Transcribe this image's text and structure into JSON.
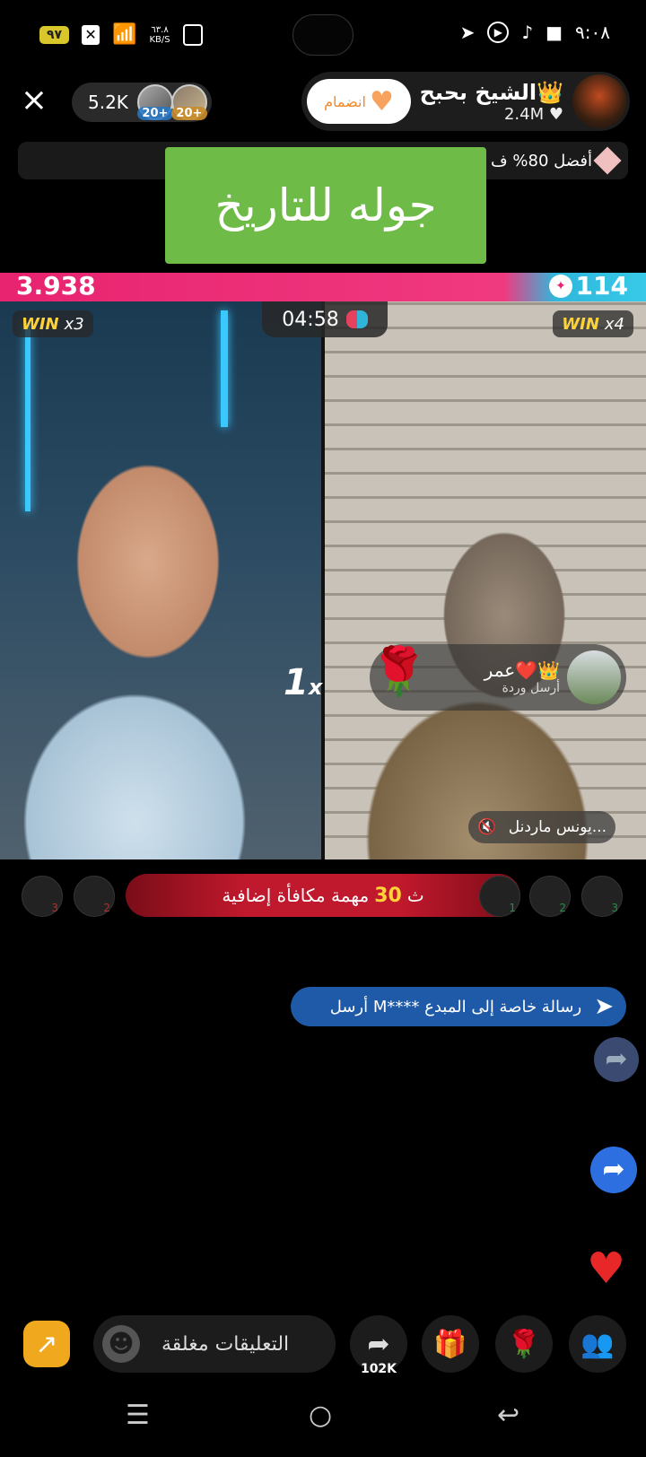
{
  "status_bar": {
    "battery": "٩٧",
    "speed_top": "٦٣.٨",
    "speed_bottom": "KB/S",
    "time": "٩:٠٨",
    "icons": [
      "telegram-icon",
      "youtube-icon",
      "tiktok-icon",
      "camera-icon",
      "wifi-icon",
      "vibrate-icon"
    ]
  },
  "header": {
    "viewer_count": "5.2K",
    "viewer_avatars": [
      {
        "badge": "20+"
      },
      {
        "badge": "20+"
      }
    ],
    "host_name": "الشيخ بحبح👑",
    "host_likes": "2.4M",
    "join_label": "انضمام"
  },
  "subbar": {
    "text": "أفضل 80% ف"
  },
  "sticker": {
    "text": "جوله للتاريخ"
  },
  "battle": {
    "score_left": "3.938",
    "score_right": "114",
    "win_left_label": "WIN",
    "win_left_mult": "x3",
    "win_right_label": "WIN",
    "win_right_mult": "x4",
    "timer": "04:58",
    "multiplier": "1",
    "multiplier_suffix": "x",
    "gift_sender": "عمر❤️👑",
    "gift_action": "أرسل وردة",
    "right_user": "يونس ماردنل...",
    "bonus_text": "مهمة مكافأة إضافية",
    "bonus_value": "30",
    "bonus_unit": "ث",
    "supporters_left": [
      "3",
      "2"
    ],
    "supporters_right": [
      "1",
      "2",
      "3"
    ]
  },
  "message": {
    "text": "أرسل M**** رسالة خاصة إلى المبدع"
  },
  "bottom_bar": {
    "comments_label": "التعليقات مغلقة",
    "share_count": "102K"
  },
  "colors": {
    "accent_pink": "#e8236f",
    "accent_blue": "#37c9e8",
    "bonus_red": "#c0182c",
    "message_blue": "#1e5aa8"
  }
}
